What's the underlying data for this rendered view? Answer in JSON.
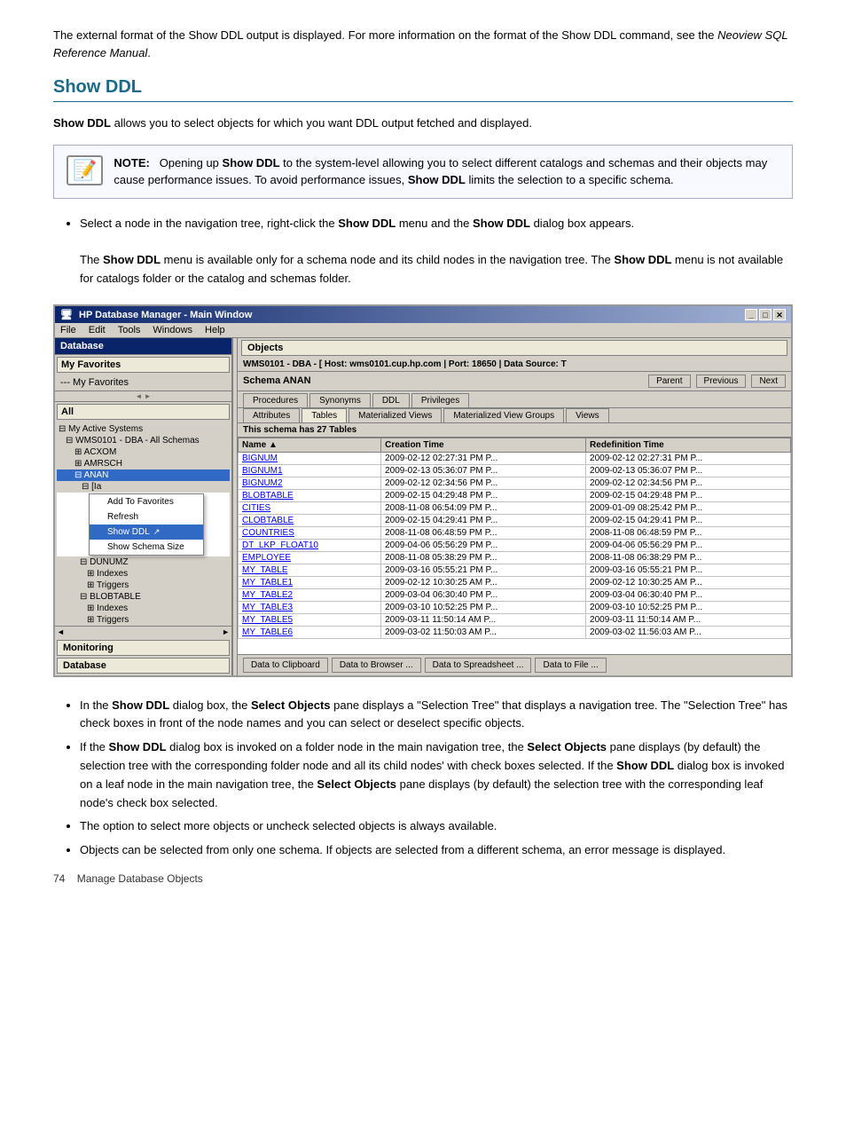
{
  "intro": {
    "text": "The external format of the Show DDL output is displayed. For more information on the format of the Show DDL command, see the ",
    "italic": "Neoview SQL Reference Manual",
    "text_end": "."
  },
  "section": {
    "title": "Show DDL",
    "desc_bold": "Show DDL",
    "desc_text": " allows you to select objects for which you want DDL output fetched and displayed."
  },
  "note": {
    "label": "NOTE:",
    "text_parts": [
      "Opening up ",
      "Show DDL",
      " to the system-level allowing you to select different catalogs and schemas and their objects may cause performance issues. To avoid performance issues, ",
      "Show DDL",
      " limits the selection to a specific schema."
    ]
  },
  "bullets": [
    {
      "parts": [
        "Select a node in the navigation tree, right-click the ",
        "Show DDL",
        " menu and the ",
        "Show DDL",
        " dialog box appears."
      ]
    }
  ],
  "subtext": {
    "text": "The ",
    "b1": "Show DDL",
    "mid": " menu is available only for a schema node and its child nodes in the navigation tree. The ",
    "b2": "Show DDL",
    "end": " menu is not available for catalogs folder or the catalog and schemas folder."
  },
  "screenshot": {
    "title": "HP Database Manager - Main Window",
    "title_icon": "🖥",
    "menu_items": [
      "File",
      "Edit",
      "Tools",
      "Windows",
      "Help"
    ],
    "sidebar_header": "Database",
    "favorites_header": "My Favorites",
    "favorites_item": "--- My Favorites",
    "all_header": "All",
    "tree_items": [
      "⊟ My Active Systems",
      "  ⊟ WMS0101 - DBA - All Schemas",
      "      ⊞ ACXOM",
      "      ⊞ AMRSCH",
      "      ⊟ ANAN",
      "        ⊟ [Ia",
      "          ⊟",
      "          ⊟"
    ],
    "context_menu": [
      "Add To Favorites",
      "Refresh",
      "Show DDL",
      "Show Schema Size"
    ],
    "tree_after_menu": [
      "      ⊞ DUNUMZ",
      "      ⊞ Indexes",
      "      ⊞ Triggers",
      "      ⊟ BLOBTABLE",
      "        ⊞ Indexes",
      "        ⊞ Triggers"
    ],
    "connection": "WMS0101 - DBA - [ Host: wms0101.cup.hp.com | Port: 18650 | Data Source: T",
    "schema": "Schema  ANAN",
    "nav_buttons": [
      "Parent",
      "Previous",
      "Next"
    ],
    "tabs1": [
      "Procedures",
      "Synonyms",
      "DDL",
      "Privileges"
    ],
    "tabs2": [
      "Attributes",
      "Tables",
      "Materialized Views",
      "Materialized View Groups",
      "Views"
    ],
    "schema_count": "This schema has 27 Tables",
    "table_headers": [
      "Name",
      "Creation Time",
      "Redefinition Time"
    ],
    "table_rows": [
      [
        "BIGNUM",
        "2009-02-12 02:27:31 PM P...",
        "2009-02-12 02:27:31 PM P..."
      ],
      [
        "BIGNUM1",
        "2009-02-13 05:36:07 PM P...",
        "2009-02-13 05:36:07 PM P..."
      ],
      [
        "BIGNUM2",
        "2009-02-12 02:34:56 PM P...",
        "2009-02-12 02:34:56 PM P..."
      ],
      [
        "BLOBTABLE",
        "2009-02-15 04:29:48 PM P...",
        "2009-02-15 04:29:48 PM P..."
      ],
      [
        "CITIES",
        "2008-11-08 06:54:09 PM P...",
        "2009-01-09 08:25:42 PM P..."
      ],
      [
        "CLOBTABLE",
        "2009-02-15 04:29:41 PM P...",
        "2009-02-15 04:29:41 PM P..."
      ],
      [
        "COUNTRIES",
        "2008-11-08 06:48:59 PM P...",
        "2008-11-08 06:48:59 PM P..."
      ],
      [
        "DT_LKP_FLOAT10",
        "2009-04-06 05:56:29 PM P...",
        "2009-04-06 05:56:29 PM P..."
      ],
      [
        "EMPLOYEE",
        "2008-11-08 05:38:29 PM P...",
        "2008-11-08 06:38:29 PM P..."
      ],
      [
        "MY_TABLE",
        "2009-03-16 05:55:21 PM P...",
        "2009-03-16 05:55:21 PM P..."
      ],
      [
        "MY_TABLE1",
        "2009-02-12 10:30:25 AM P...",
        "2009-02-12 10:30:25 AM P..."
      ],
      [
        "MY_TABLE2",
        "2009-03-04 06:30:40 PM P...",
        "2009-03-04 06:30:40 PM P..."
      ],
      [
        "MY_TABLE3",
        "2009-03-10 10:52:25 PM P...",
        "2009-03-10 10:52:25 PM P..."
      ],
      [
        "MY_TABLE5",
        "2009-03-11 11:50:14 AM P...",
        "2009-03-11 11:50:14 AM P..."
      ],
      [
        "MY_TABLE6",
        "2009-03-02 11:50:03 AM P...",
        "2009-03-02 11:56:03 AM P..."
      ]
    ],
    "bottom_buttons": [
      "Data to Clipboard",
      "Data to Browser ...",
      "Data to Spreadsheet ...",
      "Data to File ..."
    ],
    "monitoring_label": "Monitoring",
    "database_label": "Database"
  },
  "bullets2": [
    {
      "parts": [
        "In the ",
        "Show DDL",
        " dialog box, the ",
        "Select Objects",
        " pane displays a “Selection Tree” that displays a navigation tree. The “Selection Tree” has check boxes in front of the node names and you can select or deselect specific objects."
      ]
    },
    {
      "parts": [
        "If the ",
        "Show DDL",
        " dialog box is invoked on a folder node in the main navigation tree, the ",
        "Select Objects",
        " pane displays (by default) the selection tree with the corresponding folder node and all its child nodes’ with check boxes selected. If the ",
        "Show DDL",
        " dialog box is invoked on a leaf node in the main navigation tree, the ",
        "Select Objects",
        " pane displays (by default) the selection tree with the corresponding leaf node’s check box selected."
      ]
    },
    {
      "text_plain": "The option to select more objects or uncheck selected objects is always available."
    },
    {
      "text_plain": "Objects can be selected from only one schema. If objects are selected from a different schema, an error message is displayed."
    }
  ],
  "footer": {
    "page_num": "74",
    "text": "Manage Database Objects"
  }
}
